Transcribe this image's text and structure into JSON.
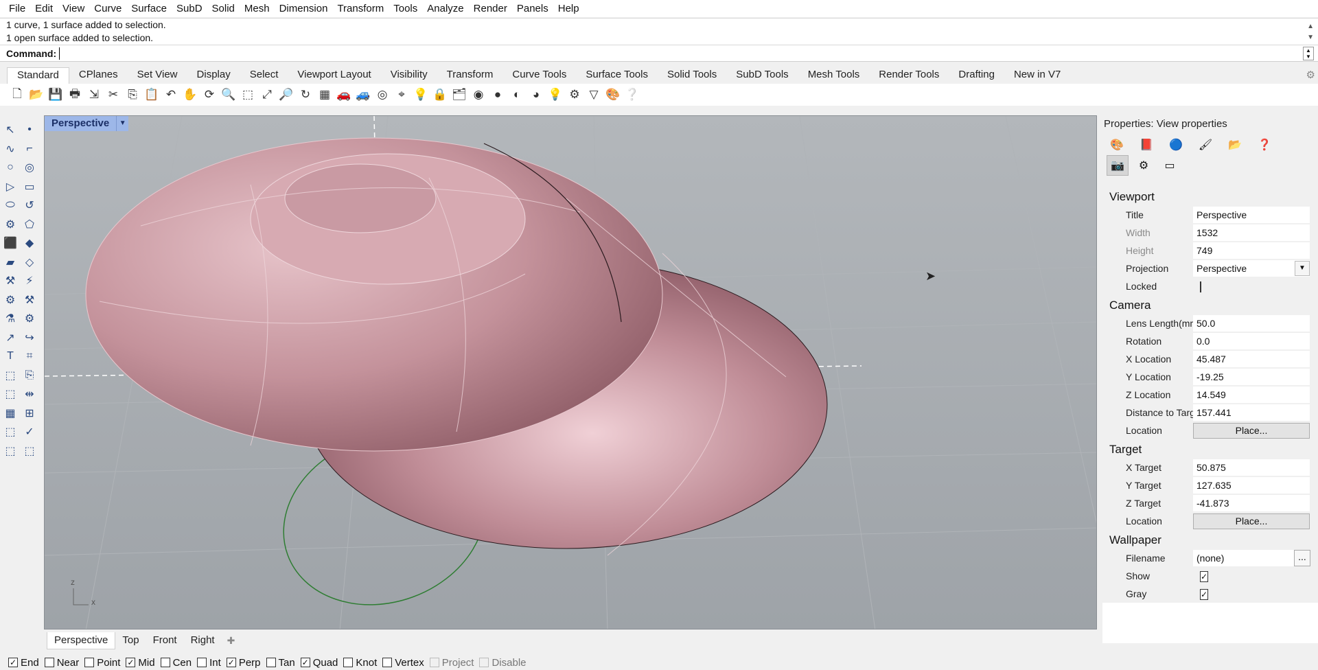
{
  "menubar": {
    "items": [
      "File",
      "Edit",
      "View",
      "Curve",
      "Surface",
      "SubD",
      "Solid",
      "Mesh",
      "Dimension",
      "Transform",
      "Tools",
      "Analyze",
      "Render",
      "Panels",
      "Help"
    ]
  },
  "command": {
    "history": [
      "1 curve, 1 surface added to selection.",
      "1 open surface added to selection."
    ],
    "prompt_label": "Command:",
    "value": ""
  },
  "toolbar_tabs": [
    "Standard",
    "CPlanes",
    "Set View",
    "Display",
    "Select",
    "Viewport Layout",
    "Visibility",
    "Transform",
    "Curve Tools",
    "Surface Tools",
    "Solid Tools",
    "SubD Tools",
    "Mesh Tools",
    "Render Tools",
    "Drafting",
    "New in V7"
  ],
  "toolbar_icons": [
    "new-icon",
    "open-icon",
    "save-icon",
    "print-icon",
    "import-icon",
    "cut-icon",
    "copy-icon",
    "paste-icon",
    "undo-icon",
    "pan-icon",
    "rotate-view-icon",
    "zoom-icon",
    "zoom-window-icon",
    "zoom-extents-icon",
    "zoom-selected-icon",
    "zoom-dynamic-icon",
    "grid-icon",
    "car-icon",
    "car2-icon",
    "cplane-icon",
    "osnap-icon",
    "light-icon",
    "lock-icon",
    "layers-icon",
    "color-icon",
    "shade-icon",
    "render-preview-icon",
    "sphere-icon",
    "light-bulb-icon",
    "options-icon",
    "filter-icon",
    "materials-icon",
    "help-icon"
  ],
  "viewport": {
    "title": "Perspective",
    "axis_z": "z",
    "axis_x": "x"
  },
  "viewport_tabs": [
    "Perspective",
    "Top",
    "Front",
    "Right"
  ],
  "properties": {
    "title": "Properties: View properties",
    "sections": {
      "viewport": {
        "label": "Viewport",
        "title_label": "Title",
        "title_value": "Perspective",
        "width_label": "Width",
        "width_value": "1532",
        "height_label": "Height",
        "height_value": "749",
        "projection_label": "Projection",
        "projection_value": "Perspective",
        "locked_label": "Locked",
        "locked": false
      },
      "camera": {
        "label": "Camera",
        "lens_label": "Lens Length(mm)",
        "lens_value": "50.0",
        "rotation_label": "Rotation",
        "rotation_value": "0.0",
        "xloc_label": "X Location",
        "xloc_value": "45.487",
        "yloc_label": "Y Location",
        "yloc_value": "-19.25",
        "zloc_label": "Z Location",
        "zloc_value": "14.549",
        "dist_label": "Distance to Targ...",
        "dist_value": "157.441",
        "location_label": "Location",
        "place_button": "Place..."
      },
      "target": {
        "label": "Target",
        "xt_label": "X Target",
        "xt_value": "50.875",
        "yt_label": "Y Target",
        "yt_value": "127.635",
        "zt_label": "Z Target",
        "zt_value": "-41.873",
        "location_label": "Location",
        "place_button": "Place..."
      },
      "wallpaper": {
        "label": "Wallpaper",
        "filename_label": "Filename",
        "filename_value": "(none)",
        "browse_button": "...",
        "show_label": "Show",
        "show": true,
        "gray_label": "Gray",
        "gray": true
      }
    }
  },
  "osnaps": [
    {
      "label": "End",
      "checked": true,
      "enabled": true
    },
    {
      "label": "Near",
      "checked": false,
      "enabled": true
    },
    {
      "label": "Point",
      "checked": false,
      "enabled": true
    },
    {
      "label": "Mid",
      "checked": true,
      "enabled": true
    },
    {
      "label": "Cen",
      "checked": false,
      "enabled": true
    },
    {
      "label": "Int",
      "checked": false,
      "enabled": true
    },
    {
      "label": "Perp",
      "checked": true,
      "enabled": true
    },
    {
      "label": "Tan",
      "checked": false,
      "enabled": true
    },
    {
      "label": "Quad",
      "checked": true,
      "enabled": true
    },
    {
      "label": "Knot",
      "checked": false,
      "enabled": true
    },
    {
      "label": "Vertex",
      "checked": false,
      "enabled": true
    },
    {
      "label": "Project",
      "checked": false,
      "enabled": false
    },
    {
      "label": "Disable",
      "checked": false,
      "enabled": false
    }
  ],
  "colors": {
    "viewport_bg": "#a4a9ae",
    "surface": "#c99aa3",
    "viewport_title_bg": "#9db7e8",
    "green_curve": "#2e7d32"
  }
}
